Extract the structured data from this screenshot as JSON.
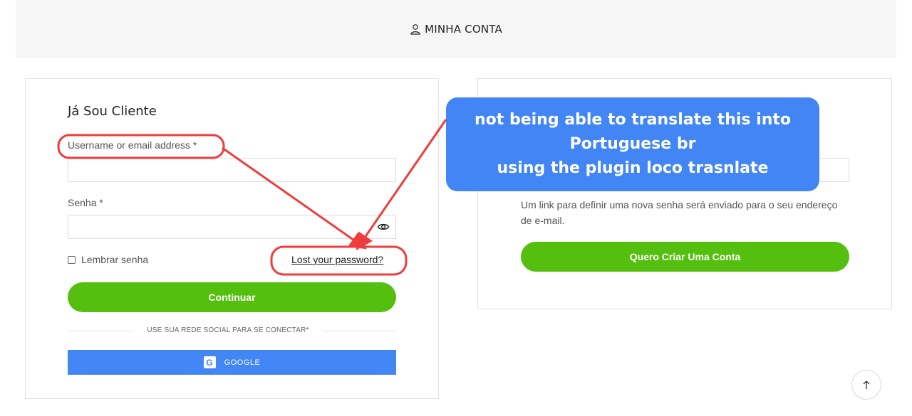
{
  "header": {
    "title": "MINHA CONTA",
    "icon": "user-icon"
  },
  "login": {
    "title": "Já Sou Cliente",
    "username_label": "Username or email address *",
    "username_value": "",
    "password_label": "Senha *",
    "password_value": "",
    "remember_label": "Lembrar senha",
    "remember_checked": false,
    "lost_password_link": "Lost your password?",
    "continue_button": "Continuar",
    "social_divider_text": "USE SUA REDE SOCIAL PARA SE CONECTAR*",
    "google_button": "GOOGLE",
    "google_icon_letter": "G"
  },
  "register": {
    "hint": "Um link para definir uma nova senha será enviado para o seu endereço de e-mail.",
    "create_account_button": "Quero Criar Uma Conta"
  },
  "annotation": {
    "line1": "not being able to translate this into",
    "line2": "Portuguese br",
    "line3": "using the plugin loco trasnlate"
  },
  "colors": {
    "accent_green": "#55bf0f",
    "google_blue": "#4285f4",
    "annotation_red": "#f03c3c"
  }
}
